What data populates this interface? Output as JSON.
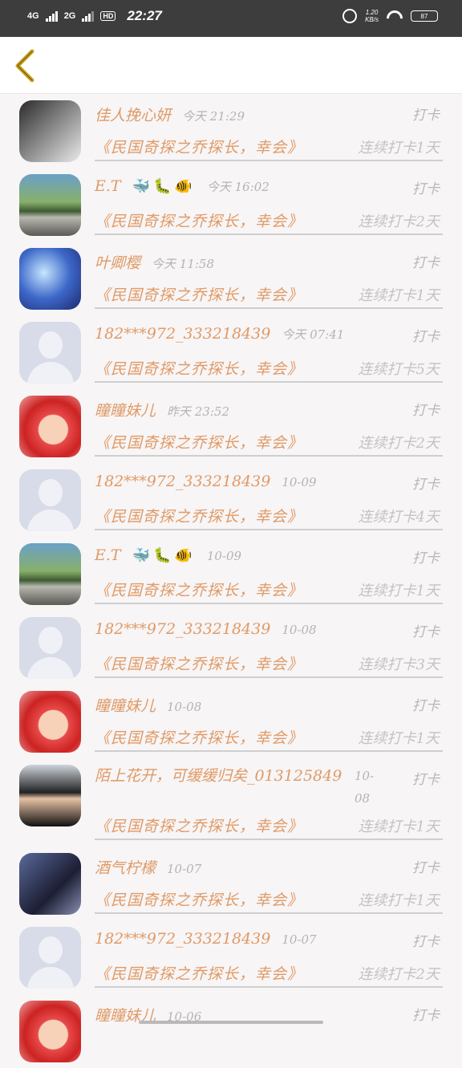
{
  "status_bar": {
    "net1": "4G",
    "net2": "2G",
    "hd": "HD",
    "time": "22:27",
    "speed_value": "1.20",
    "speed_unit": "KB/s",
    "battery": "87"
  },
  "header": {
    "back_icon": "chevron-left-icon",
    "accent": "#c9a320"
  },
  "records": [
    {
      "name": "佳人挽心妍",
      "date": "今天 21:29",
      "action": "打卡",
      "book": "《民国奇探之乔探长，幸会》",
      "streak": "连续打卡1天",
      "avatar": "photo1"
    },
    {
      "name": "E.T",
      "emoji": "🐳🐛🐠",
      "date": "今天 16:02",
      "action": "打卡",
      "book": "《民国奇探之乔探长，幸会》",
      "streak": "连续打卡2天",
      "avatar": "scene"
    },
    {
      "name": "叶卿樱",
      "date": "今天 11:58",
      "action": "打卡",
      "book": "《民国奇探之乔探长，幸会》",
      "streak": "连续打卡1天",
      "avatar": "anime"
    },
    {
      "name": "182***972_333218439",
      "date": "今天 07:41",
      "action": "打卡",
      "book": "《民国奇探之乔探长，幸会》",
      "streak": "连续打卡5天",
      "avatar": "default"
    },
    {
      "name": "瞳瞳妹儿",
      "date": "昨天 23:52",
      "action": "打卡",
      "book": "《民国奇探之乔探长，幸会》",
      "streak": "连续打卡2天",
      "avatar": "shin"
    },
    {
      "name": "182***972_333218439",
      "date": "10-09",
      "action": "打卡",
      "book": "《民国奇探之乔探长，幸会》",
      "streak": "连续打卡4天",
      "avatar": "default"
    },
    {
      "name": "E.T",
      "emoji": "🐳🐛🐠",
      "date": "10-09",
      "action": "打卡",
      "book": "《民国奇探之乔探长，幸会》",
      "streak": "连续打卡1天",
      "avatar": "scene"
    },
    {
      "name": "182***972_333218439",
      "date": "10-08",
      "action": "打卡",
      "book": "《民国奇探之乔探长，幸会》",
      "streak": "连续打卡3天",
      "avatar": "default"
    },
    {
      "name": "瞳瞳妹儿",
      "date": "10-08",
      "action": "打卡",
      "book": "《民国奇探之乔探长，幸会》",
      "streak": "连续打卡1天",
      "avatar": "shin"
    },
    {
      "name": "陌上花开，可缓缓归矣_013125849",
      "date": "10-08",
      "action": "打卡",
      "book": "《民国奇探之乔探长，幸会》",
      "streak": "连续打卡1天",
      "avatar": "boy",
      "tall": true
    },
    {
      "name": "酒气柠檬",
      "date": "10-07",
      "action": "打卡",
      "book": "《民国奇探之乔探长，幸会》",
      "streak": "连续打卡1天",
      "avatar": "girl"
    },
    {
      "name": "182***972_333218439",
      "date": "10-07",
      "action": "打卡",
      "book": "《民国奇探之乔探长，幸会》",
      "streak": "连续打卡2天",
      "avatar": "default"
    },
    {
      "name": "瞳瞳妹儿",
      "date": "10-06",
      "action": "打卡",
      "book": "",
      "streak": "",
      "avatar": "shin"
    }
  ]
}
